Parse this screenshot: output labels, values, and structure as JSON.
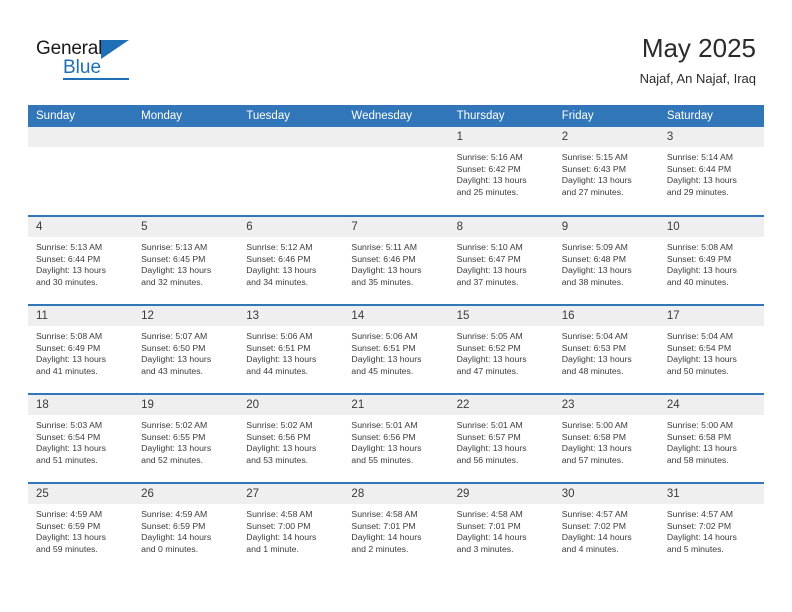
{
  "brand": {
    "name_part1": "General",
    "name_part2": "Blue",
    "triangle_icon": "triangle-icon",
    "accent_color": "#1e6fb5"
  },
  "header": {
    "title": "May 2025",
    "subtitle": "Najaf, An Najaf, Iraq"
  },
  "colors": {
    "header_blue": "#3176b8",
    "daynum_gray": "#efefef",
    "text": "#3b3b3b"
  },
  "calendar": {
    "weekday_headers": [
      "Sunday",
      "Monday",
      "Tuesday",
      "Wednesday",
      "Thursday",
      "Friday",
      "Saturday"
    ],
    "weeks": [
      [
        {
          "day": "",
          "lines": []
        },
        {
          "day": "",
          "lines": []
        },
        {
          "day": "",
          "lines": []
        },
        {
          "day": "",
          "lines": []
        },
        {
          "day": "1",
          "lines": [
            "Sunrise: 5:16 AM",
            "Sunset: 6:42 PM",
            "Daylight: 13 hours",
            "and 25 minutes."
          ]
        },
        {
          "day": "2",
          "lines": [
            "Sunrise: 5:15 AM",
            "Sunset: 6:43 PM",
            "Daylight: 13 hours",
            "and 27 minutes."
          ]
        },
        {
          "day": "3",
          "lines": [
            "Sunrise: 5:14 AM",
            "Sunset: 6:44 PM",
            "Daylight: 13 hours",
            "and 29 minutes."
          ]
        }
      ],
      [
        {
          "day": "4",
          "lines": [
            "Sunrise: 5:13 AM",
            "Sunset: 6:44 PM",
            "Daylight: 13 hours",
            "and 30 minutes."
          ]
        },
        {
          "day": "5",
          "lines": [
            "Sunrise: 5:13 AM",
            "Sunset: 6:45 PM",
            "Daylight: 13 hours",
            "and 32 minutes."
          ]
        },
        {
          "day": "6",
          "lines": [
            "Sunrise: 5:12 AM",
            "Sunset: 6:46 PM",
            "Daylight: 13 hours",
            "and 34 minutes."
          ]
        },
        {
          "day": "7",
          "lines": [
            "Sunrise: 5:11 AM",
            "Sunset: 6:46 PM",
            "Daylight: 13 hours",
            "and 35 minutes."
          ]
        },
        {
          "day": "8",
          "lines": [
            "Sunrise: 5:10 AM",
            "Sunset: 6:47 PM",
            "Daylight: 13 hours",
            "and 37 minutes."
          ]
        },
        {
          "day": "9",
          "lines": [
            "Sunrise: 5:09 AM",
            "Sunset: 6:48 PM",
            "Daylight: 13 hours",
            "and 38 minutes."
          ]
        },
        {
          "day": "10",
          "lines": [
            "Sunrise: 5:08 AM",
            "Sunset: 6:49 PM",
            "Daylight: 13 hours",
            "and 40 minutes."
          ]
        }
      ],
      [
        {
          "day": "11",
          "lines": [
            "Sunrise: 5:08 AM",
            "Sunset: 6:49 PM",
            "Daylight: 13 hours",
            "and 41 minutes."
          ]
        },
        {
          "day": "12",
          "lines": [
            "Sunrise: 5:07 AM",
            "Sunset: 6:50 PM",
            "Daylight: 13 hours",
            "and 43 minutes."
          ]
        },
        {
          "day": "13",
          "lines": [
            "Sunrise: 5:06 AM",
            "Sunset: 6:51 PM",
            "Daylight: 13 hours",
            "and 44 minutes."
          ]
        },
        {
          "day": "14",
          "lines": [
            "Sunrise: 5:06 AM",
            "Sunset: 6:51 PM",
            "Daylight: 13 hours",
            "and 45 minutes."
          ]
        },
        {
          "day": "15",
          "lines": [
            "Sunrise: 5:05 AM",
            "Sunset: 6:52 PM",
            "Daylight: 13 hours",
            "and 47 minutes."
          ]
        },
        {
          "day": "16",
          "lines": [
            "Sunrise: 5:04 AM",
            "Sunset: 6:53 PM",
            "Daylight: 13 hours",
            "and 48 minutes."
          ]
        },
        {
          "day": "17",
          "lines": [
            "Sunrise: 5:04 AM",
            "Sunset: 6:54 PM",
            "Daylight: 13 hours",
            "and 50 minutes."
          ]
        }
      ],
      [
        {
          "day": "18",
          "lines": [
            "Sunrise: 5:03 AM",
            "Sunset: 6:54 PM",
            "Daylight: 13 hours",
            "and 51 minutes."
          ]
        },
        {
          "day": "19",
          "lines": [
            "Sunrise: 5:02 AM",
            "Sunset: 6:55 PM",
            "Daylight: 13 hours",
            "and 52 minutes."
          ]
        },
        {
          "day": "20",
          "lines": [
            "Sunrise: 5:02 AM",
            "Sunset: 6:56 PM",
            "Daylight: 13 hours",
            "and 53 minutes."
          ]
        },
        {
          "day": "21",
          "lines": [
            "Sunrise: 5:01 AM",
            "Sunset: 6:56 PM",
            "Daylight: 13 hours",
            "and 55 minutes."
          ]
        },
        {
          "day": "22",
          "lines": [
            "Sunrise: 5:01 AM",
            "Sunset: 6:57 PM",
            "Daylight: 13 hours",
            "and 56 minutes."
          ]
        },
        {
          "day": "23",
          "lines": [
            "Sunrise: 5:00 AM",
            "Sunset: 6:58 PM",
            "Daylight: 13 hours",
            "and 57 minutes."
          ]
        },
        {
          "day": "24",
          "lines": [
            "Sunrise: 5:00 AM",
            "Sunset: 6:58 PM",
            "Daylight: 13 hours",
            "and 58 minutes."
          ]
        }
      ],
      [
        {
          "day": "25",
          "lines": [
            "Sunrise: 4:59 AM",
            "Sunset: 6:59 PM",
            "Daylight: 13 hours",
            "and 59 minutes."
          ]
        },
        {
          "day": "26",
          "lines": [
            "Sunrise: 4:59 AM",
            "Sunset: 6:59 PM",
            "Daylight: 14 hours",
            "and 0 minutes."
          ]
        },
        {
          "day": "27",
          "lines": [
            "Sunrise: 4:58 AM",
            "Sunset: 7:00 PM",
            "Daylight: 14 hours",
            "and 1 minute."
          ]
        },
        {
          "day": "28",
          "lines": [
            "Sunrise: 4:58 AM",
            "Sunset: 7:01 PM",
            "Daylight: 14 hours",
            "and 2 minutes."
          ]
        },
        {
          "day": "29",
          "lines": [
            "Sunrise: 4:58 AM",
            "Sunset: 7:01 PM",
            "Daylight: 14 hours",
            "and 3 minutes."
          ]
        },
        {
          "day": "30",
          "lines": [
            "Sunrise: 4:57 AM",
            "Sunset: 7:02 PM",
            "Daylight: 14 hours",
            "and 4 minutes."
          ]
        },
        {
          "day": "31",
          "lines": [
            "Sunrise: 4:57 AM",
            "Sunset: 7:02 PM",
            "Daylight: 14 hours",
            "and 5 minutes."
          ]
        }
      ]
    ]
  }
}
